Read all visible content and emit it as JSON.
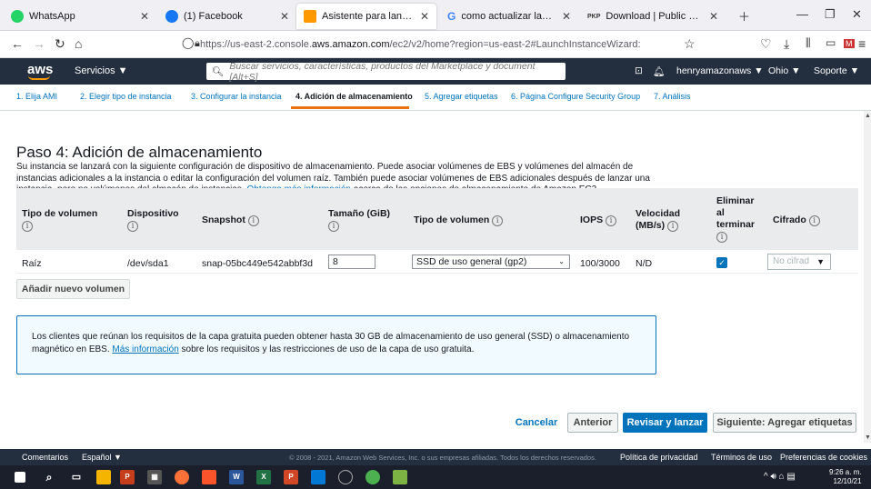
{
  "browser": {
    "tabs": [
      {
        "title": "WhatsApp",
        "icon": "whatsapp-icon",
        "color": "#25d366"
      },
      {
        "title": "(1) Facebook",
        "icon": "facebook-icon",
        "color": "#1877f2"
      },
      {
        "title": "Asistente para lanzar instancia | ",
        "icon": "aws-icon",
        "color": "#ff9900"
      },
      {
        "title": "como actualizar lamp server - ",
        "icon": "google-icon",
        "color": "#4285f4"
      },
      {
        "title": "Download | Public Knowledge P",
        "icon": "pkp-icon",
        "color": "#333333"
      }
    ],
    "url_prefix": "https://us-east-2.console.",
    "url_domain": "aws.amazon.com",
    "url_suffix": "/ec2/v2/home?region=us-east-2#LaunchInstanceWizard:"
  },
  "aws_nav": {
    "logo": "aws",
    "services": "Servicios ▼",
    "search_placeholder": "Buscar servicios, características, productos del Marketplace y document  [Alt+S]",
    "user": "henryamazonaws ▼",
    "region": "Ohio ▼",
    "support": "Soporte ▼"
  },
  "steps": [
    "1. Elija AMI",
    "2. Elegir tipo de instancia",
    "3. Configurar la instancia",
    "4. Adición de almacenamiento",
    "5. Agregar etiquetas",
    "6. Página Configure Security Group",
    "7. Análisis"
  ],
  "page": {
    "title": "Paso 4: Adición de almacenamiento",
    "desc_1": "Su instancia se lanzará con la siguiente configuración de dispositivo de almacenamiento. Puede asociar volúmenes de EBS y volúmenes del almacén de instancias adicionales a la instancia o editar la configuración del volumen raíz. También puede asociar volúmenes de EBS adicionales después de lanzar una instancia, pero no volúmenes del almacén de instancias. ",
    "desc_link": "Obtenga más información",
    "desc_2": " acerca de las opciones de almacenamiento de Amazon EC2."
  },
  "table": {
    "headers": {
      "tipo": "Tipo de volumen",
      "dispositivo": "Dispositivo",
      "snapshot": "Snapshot",
      "tamano": "Tamaño (GiB)",
      "tipo_volumen": "Tipo de volumen",
      "iops": "IOPS",
      "velocidad": "Velocidad (MB/s)",
      "eliminar": "Eliminar al terminar",
      "cifrado": "Cifrado"
    },
    "row": {
      "tipo": "Raíz",
      "dispositivo": "/dev/sda1",
      "snapshot": "snap-05bc449e542abbf3d",
      "tamano": "8",
      "tipo_volumen": "SSD de uso general (gp2)",
      "iops": "100/3000",
      "velocidad": "N/D",
      "cifrado": "No cifrad"
    },
    "add_button": "Añadir nuevo volumen"
  },
  "info_box": {
    "text_1": "Los clientes que reúnan los requisitos de la capa gratuita pueden obtener hasta 30 GB de almacenamiento de uso general (SSD) o almacenamiento magnético en EBS. ",
    "link": "Más información",
    "text_2": " sobre los requisitos y las restricciones de uso de la capa de uso gratuita."
  },
  "buttons": {
    "cancel": "Cancelar",
    "previous": "Anterior",
    "review": "Revisar y lanzar",
    "next": "Siguiente: Agregar etiquetas"
  },
  "footer": {
    "comments": "Comentarios",
    "language": "Español ▼",
    "copyright": "© 2008 - 2021, Amazon Web Services, Inc. o sus empresas afiliadas. Todos los derechos reservados.",
    "privacy": "Política de privacidad",
    "terms": "Términos de uso",
    "cookies": "Preferencias de cookies"
  },
  "taskbar": {
    "time": "9:26 a. m.",
    "date": "12/10/21"
  },
  "colors": {
    "aws_dark": "#232f3e",
    "aws_orange": "#ec7211",
    "link_blue": "#0073bb"
  }
}
